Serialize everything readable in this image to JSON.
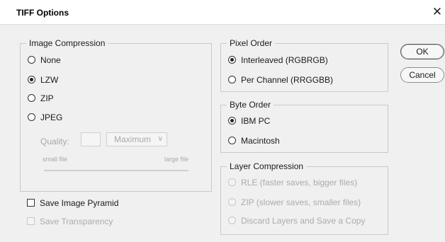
{
  "dialog": {
    "title": "TIFF Options"
  },
  "image_compression": {
    "legend": "Image Compression",
    "options": [
      {
        "label": "None",
        "selected": false
      },
      {
        "label": "LZW",
        "selected": true
      },
      {
        "label": "ZIP",
        "selected": false
      },
      {
        "label": "JPEG",
        "selected": false
      }
    ],
    "quality": {
      "label": "Quality:",
      "value": "",
      "select_value": "Maximum",
      "small_label": "small file",
      "large_label": "large file"
    }
  },
  "pixel_order": {
    "legend": "Pixel Order",
    "options": [
      {
        "label": "Interleaved (RGBRGB)",
        "selected": true
      },
      {
        "label": "Per Channel (RRGGBB)",
        "selected": false
      }
    ]
  },
  "byte_order": {
    "legend": "Byte Order",
    "options": [
      {
        "label": "IBM PC",
        "selected": true
      },
      {
        "label": "Macintosh",
        "selected": false
      }
    ]
  },
  "layer_compression": {
    "legend": "Layer Compression",
    "options": [
      {
        "label": "RLE (faster saves, bigger files)",
        "selected": false
      },
      {
        "label": "ZIP (slower saves, smaller files)",
        "selected": false
      },
      {
        "label": "Discard Layers and Save a Copy",
        "selected": false
      }
    ]
  },
  "checkboxes": {
    "save_image_pyramid": {
      "label": "Save Image Pyramid",
      "checked": false
    },
    "save_transparency": {
      "label": "Save Transparency",
      "checked": false
    }
  },
  "buttons": {
    "ok": "OK",
    "cancel": "Cancel"
  }
}
